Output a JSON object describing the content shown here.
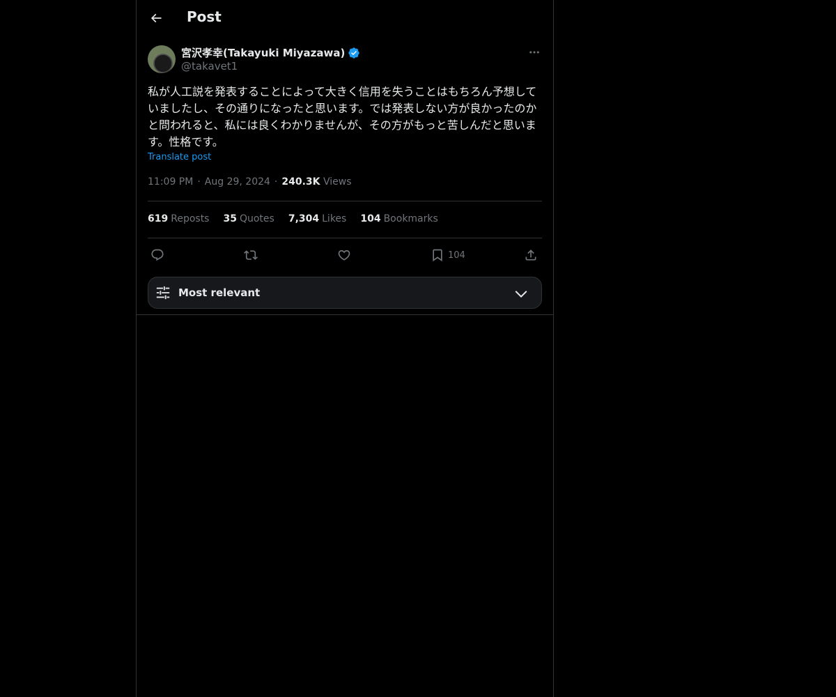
{
  "header": {
    "title": "Post",
    "back_icon": "arrow-left-icon"
  },
  "post": {
    "author": {
      "display_name": "宮沢孝幸(Takayuki Miyazawa)",
      "handle": "@takavet1",
      "verified_color": "#1d9bf0"
    },
    "text": "私が人工説を発表することによって大きく信用を失うことはもちろん予想していましたし、その通りになったと思います。では発表しない方が良かったのかと問われると、私には良くわかりませんが、その方がもっと苦しんだと思います。性格です。",
    "translate_label": "Translate post",
    "time": "11:09 PM",
    "date": "Aug 29, 2024",
    "views_count": "240.3K",
    "views_label": "Views"
  },
  "stats": [
    {
      "count": "619",
      "label": "Reposts"
    },
    {
      "count": "35",
      "label": "Quotes"
    },
    {
      "count": "7,304",
      "label": "Likes"
    },
    {
      "count": "104",
      "label": "Bookmarks"
    }
  ],
  "actions": {
    "reply_icon": "reply-icon",
    "repost_icon": "repost-icon",
    "like_icon": "heart-icon",
    "bookmark_icon": "bookmark-icon",
    "bookmark_count": "104",
    "share_icon": "share-icon"
  },
  "sort": {
    "label": "Most relevant",
    "icon": "sliders-icon"
  },
  "colors": {
    "background": "#000000",
    "text": "#e7e9ea",
    "muted": "#71767b",
    "accent": "#1d9bf0",
    "border": "#2f3336"
  }
}
